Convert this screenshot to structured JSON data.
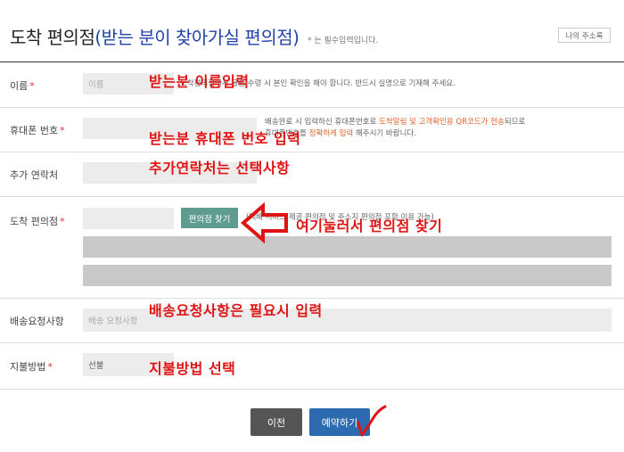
{
  "header": {
    "title_main": "도착 편의점",
    "title_sub": "(받는 분이 찾아가실 편의점)",
    "required_note": "* 는 필수입력입니다.",
    "address_book_button": "나의 주소록"
  },
  "form": {
    "name": {
      "label": "이름",
      "required": "*",
      "placeholder": "이름",
      "guide": "도착편의점에서 물품 수령 시 본인 확인을 해야 합니다. 반드시 실명으로 기재해 주세요.",
      "guide_prefix": "",
      "guide_highlight": "",
      "guide_suffix": ""
    },
    "phone": {
      "label": "휴대폰 번호",
      "required": "*",
      "guide_line1_prefix": "배송완료 시 입력하신 휴대폰번호로 ",
      "guide_line1_highlight": "도착알림 및 고객확인용 QR코드가 전송",
      "guide_line1_suffix": "되므로",
      "guide_line2_prefix": "휴대폰번호를 ",
      "guide_line2_highlight": "정확하게 입력",
      "guide_line2_suffix": " 해주시기 바랍니다."
    },
    "extra_contact": {
      "label": "추가 연락처"
    },
    "store": {
      "label": "도착 편의점",
      "required": "*",
      "find_button": "편의점 찾기",
      "guide": "(택배 서비스 제공 편의점 및 주소지 편의점 포함 이용 가능)"
    },
    "request": {
      "label": "배송요청사항",
      "placeholder": "배송 요청사항"
    },
    "payment": {
      "label": "지불방법",
      "required": "*",
      "value": "선불"
    }
  },
  "buttons": {
    "prev": "이전",
    "reserve": "예약하기"
  },
  "annotations": {
    "name": "받는분 이름입력",
    "phone": "받는분 휴대폰 번호 입력",
    "extra": "추가연락처는 선택사항",
    "store": "여기눌러서 편의점 찾기",
    "request": "배송요청사항은 필요시 입력",
    "payment": "지불방법 선택"
  },
  "colors": {
    "annotation": "#e01414",
    "find_button": "#5e9c8f",
    "reserve_button": "#2c6bb0",
    "prev_button": "#555555",
    "title_sub": "#2244aa"
  }
}
